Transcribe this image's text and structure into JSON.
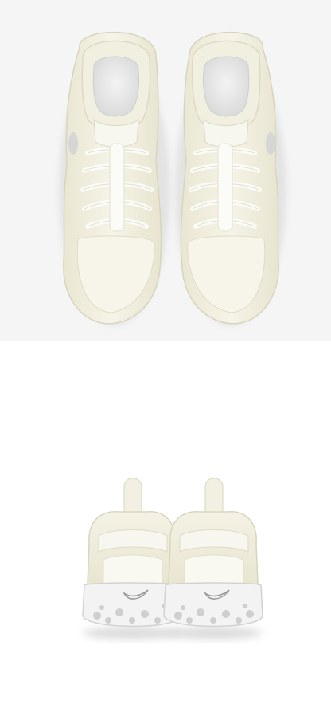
{
  "gallery": {
    "images": [
      {
        "view": "top",
        "subject": "pair-of-shoes",
        "color": "#f3f1e3"
      },
      {
        "view": "back",
        "subject": "pair-of-shoes",
        "color": "#f3f1e3"
      }
    ]
  },
  "colors": {
    "top_background": "#f5f5f5",
    "bottom_background": "#ffffff",
    "shoe_body": "#f3f1e3",
    "shoe_shade": "#e4e1cc",
    "laces": "#fbfbf8",
    "insole": "#e8e8e8",
    "outsole_grey": "#cfcfcf"
  }
}
